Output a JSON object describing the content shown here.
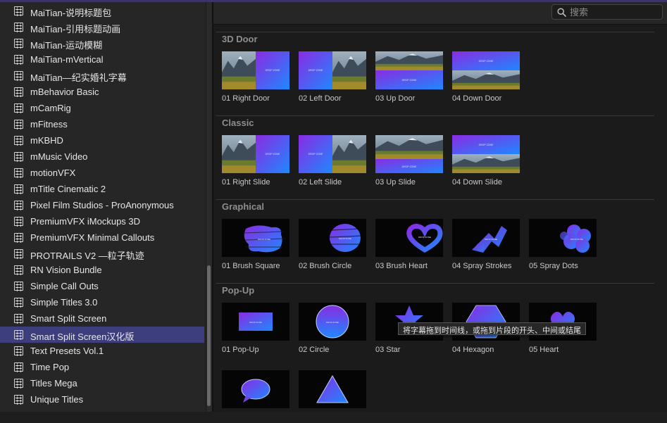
{
  "sidebar": {
    "items": [
      {
        "label": "MaiTian-说明标题包"
      },
      {
        "label": "MaiTian-引用标题动画"
      },
      {
        "label": "MaiTian-运动模糊"
      },
      {
        "label": "MaiTian-mVertical"
      },
      {
        "label": "MaiTian—纪实婚礼字幕"
      },
      {
        "label": "mBehavior Basic"
      },
      {
        "label": "mCamRig"
      },
      {
        "label": "mFitness"
      },
      {
        "label": "mKBHD"
      },
      {
        "label": "mMusic Video"
      },
      {
        "label": "motionVFX"
      },
      {
        "label": "mTitle Cinematic 2"
      },
      {
        "label": "Pixel Film Studios - ProAnonymous"
      },
      {
        "label": "PremiumVFX iMockups 3D"
      },
      {
        "label": "PremiumVFX Minimal Callouts"
      },
      {
        "label": "PROTRAILS V2 —粒子轨迹"
      },
      {
        "label": "RN Vision Bundle"
      },
      {
        "label": "Simple Call Outs"
      },
      {
        "label": "Simple Titles 3.0"
      },
      {
        "label": "Smart Split Screen"
      },
      {
        "label": "Smart Split Screen汉化版",
        "selected": true
      },
      {
        "label": "Text Presets Vol.1"
      },
      {
        "label": "Time Pop"
      },
      {
        "label": "Titles Mega"
      },
      {
        "label": "Unique Titles"
      }
    ]
  },
  "search": {
    "placeholder": "搜索",
    "value": ""
  },
  "sections": [
    {
      "title": "3D Door",
      "tiles": [
        {
          "label": "01 Right Door",
          "thumb": "door-right"
        },
        {
          "label": "02 Left Door",
          "thumb": "door-left"
        },
        {
          "label": "03 Up Door",
          "thumb": "door-up"
        },
        {
          "label": "04 Down Door",
          "thumb": "door-down"
        }
      ]
    },
    {
      "title": "Classic",
      "tiles": [
        {
          "label": "01 Right Slide",
          "thumb": "door-right"
        },
        {
          "label": "02 Left Slide",
          "thumb": "door-left"
        },
        {
          "label": "03 Up Slide",
          "thumb": "slide-up"
        },
        {
          "label": "04 Down Slide",
          "thumb": "door-down"
        }
      ]
    },
    {
      "title": "Graphical",
      "tiles": [
        {
          "label": "01 Brush Square",
          "thumb": "brush-square"
        },
        {
          "label": "02 Brush Circle",
          "thumb": "brush-circle"
        },
        {
          "label": "03 Brush Heart",
          "thumb": "brush-heart"
        },
        {
          "label": "04 Spray Strokes",
          "thumb": "spray-strokes"
        },
        {
          "label": "05 Spray Dots",
          "thumb": "spray-dots"
        }
      ]
    },
    {
      "title": "Pop-Up",
      "tiles": [
        {
          "label": "01 Pop-Up",
          "thumb": "popup-rect"
        },
        {
          "label": "02 Circle",
          "thumb": "popup-circle"
        },
        {
          "label": "03 Star",
          "thumb": "popup-star"
        },
        {
          "label": "04 Hexagon",
          "thumb": "popup-hexagon"
        },
        {
          "label": "05 Heart",
          "thumb": "popup-heart"
        },
        {
          "label": "",
          "thumb": "popup-bubble"
        },
        {
          "label": "",
          "thumb": "popup-triangle"
        }
      ]
    }
  ],
  "thumb_text": {
    "drop_zone": "DROP ZONE"
  },
  "tooltip": {
    "text": "将字幕拖到时间线，或拖到片段的开头、中间或结尾"
  },
  "colors": {
    "accent_blue": "#2f6cf5",
    "accent_purple": "#8a2be2",
    "selection": "#3d3e7d"
  }
}
